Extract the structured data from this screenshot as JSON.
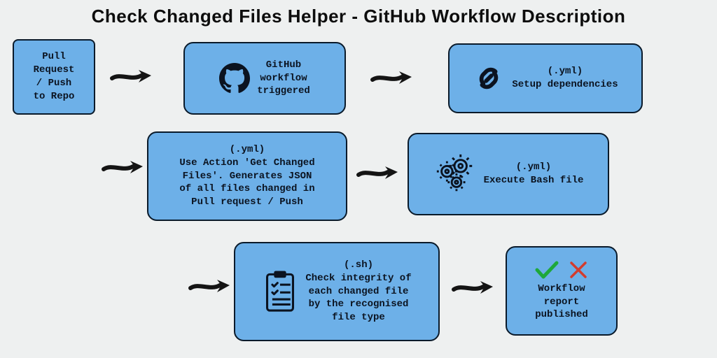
{
  "title": "Check Changed Files Helper - GitHub Workflow Description",
  "boxes": {
    "trigger": {
      "label": "Pull\nRequest\n/ Push\nto Repo"
    },
    "workflow": {
      "label": "GitHub\nworkflow\ntriggered"
    },
    "deps": {
      "tag": "(.yml)",
      "label": "Setup dependencies"
    },
    "action": {
      "tag": "(.yml)",
      "label": "Use Action 'Get Changed\nFiles'. Generates JSON\nof all files changed in\nPull request / Push"
    },
    "exec": {
      "tag": "(.yml)",
      "label": "Execute Bash file"
    },
    "check": {
      "tag": "(.sh)",
      "label": "Check integrity of\neach changed file\nby the recognised\nfile type"
    },
    "report": {
      "label": "Workflow\nreport\npublished"
    }
  },
  "icons": {
    "github": "github-icon",
    "link": "link-icon",
    "gears": "gears-icon",
    "clipboard": "clipboard-icon",
    "check": "check-icon",
    "x": "x-icon"
  },
  "colors": {
    "box_fill": "#6db0e8",
    "box_stroke": "#0a1a2a",
    "bg": "#eef0f0",
    "arrow": "#141414",
    "check": "#1ea83a",
    "x": "#d23c2e"
  }
}
